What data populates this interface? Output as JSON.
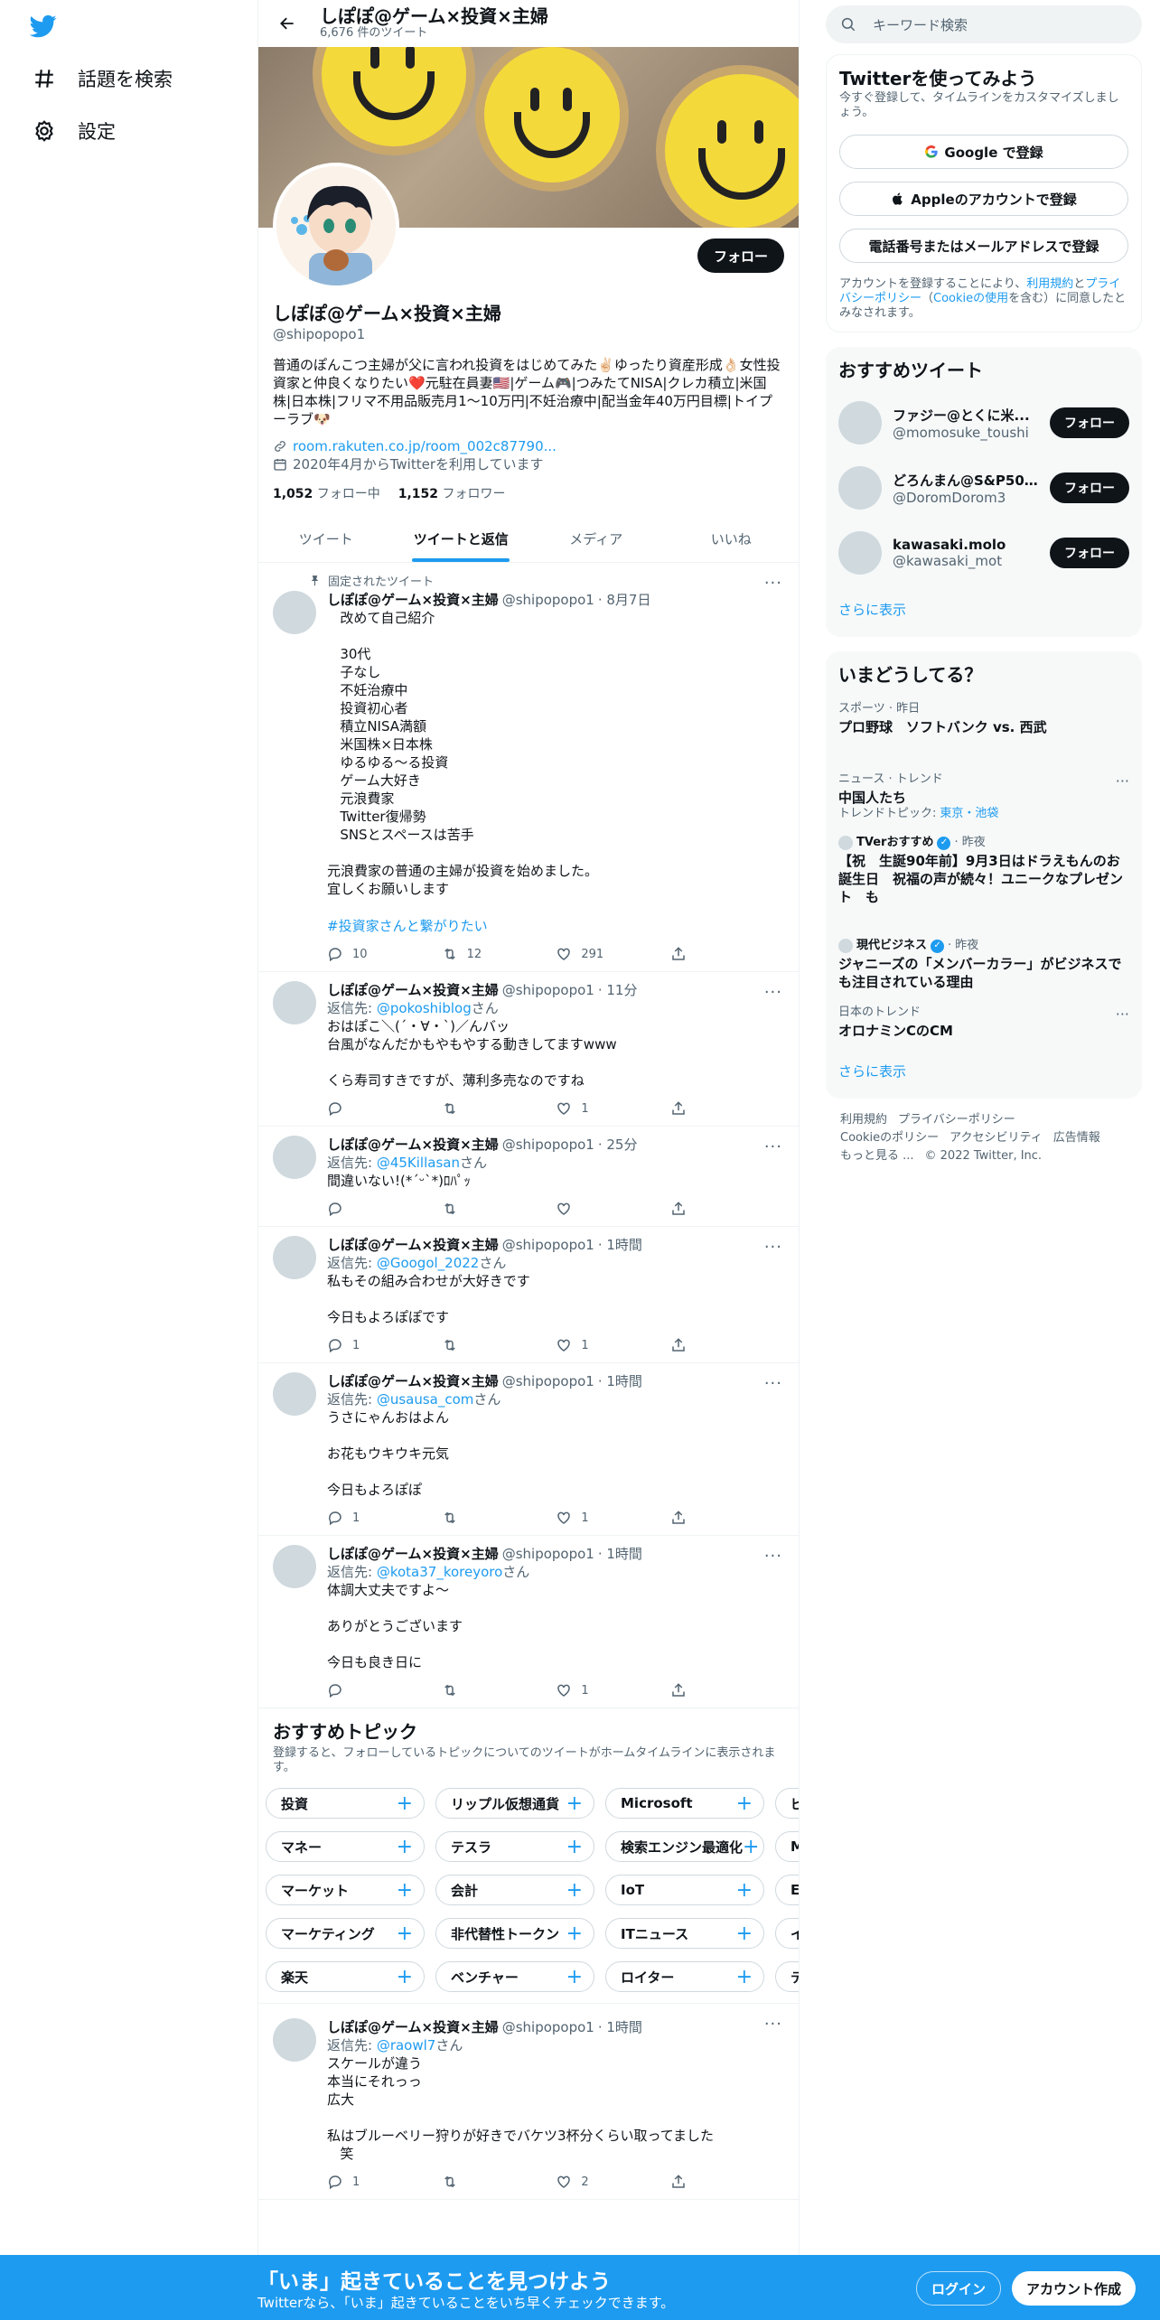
{
  "nav": {
    "explore_label": "話題を検索",
    "settings_label": "設定"
  },
  "header": {
    "title": "しぽぽ@ゲーム×投資×主婦",
    "tweet_count": "6,676 件のツイート"
  },
  "profile": {
    "follow_label": "フォロー",
    "name": "しぽぽ@ゲーム×投資×主婦",
    "handle": "@shipopopo1",
    "bio": "普通のぽんこつ主婦が父に言われ投資をはじめてみた✌🏻ゆったり資産形成👌🏻女性投資家と仲良くなりたい❤️元駐在員妻🇺🇸|ゲーム🎮|つみたてNISA|クレカ積立|米国株|日本株|フリマ不用品販売月1～10万円|不妊治療中|配当金年40万円目標|トイプーラブ🐶",
    "link": "room.rakuten.co.jp/room_002c87790...",
    "joined": "2020年4月からTwitterを利用しています",
    "following_count": "1,052",
    "following_label": "フォロー中",
    "followers_count": "1,152",
    "followers_label": "フォロワー"
  },
  "tabs": [
    {
      "label": "ツイート",
      "active": false
    },
    {
      "label": "ツイートと返信",
      "active": true
    },
    {
      "label": "メディア",
      "active": false
    },
    {
      "label": "いいね",
      "active": false
    }
  ],
  "pinned_label": "固定されたツイート",
  "tweets": [
    {
      "name": "しぽぽ@ゲーム×投資×主婦",
      "handle": "@shipopopo1",
      "time": "· 8月7日",
      "text": "   改めて自己紹介\n\n   30代\n   子なし\n   不妊治療中\n   投資初心者\n   積立NISA満額\n   米国株×日本株\n   ゆるゆる〜る投資\n   ゲーム大好き\n   元浪費家\n   Twitter復帰勢\n   SNSとスペースは苦手\n\n元浪費家の普通の主婦が投資を始めました。\n宜しくお願いします",
      "hashtag": "#投資家さんと繋がりたい",
      "replies": "10",
      "retweets": "12",
      "likes": "291"
    },
    {
      "name": "しぽぽ@ゲーム×投資×主婦",
      "handle": "@shipopopo1",
      "time": "· 11分",
      "reply_prefix": "返信先: ",
      "reply_to": "@pokoshiblog",
      "reply_suffix": "さん",
      "text": "おはぽこ＼(ˊ・∀・ˋ)／んバッ\n台風がなんだかもやもやする動きしてますwww\n\nくら寿司すきですが、薄利多売なのですね",
      "replies": "",
      "retweets": "",
      "likes": "1"
    },
    {
      "name": "しぽぽ@ゲーム×投資×主婦",
      "handle": "@shipopopo1",
      "time": "· 25分",
      "reply_prefix": "返信先: ",
      "reply_to": "@45Killasan",
      "reply_suffix": "さん",
      "text": "間違いない!(*ˊᵕˋ*)ﾛﾊﾟｯ",
      "replies": "",
      "retweets": "",
      "likes": ""
    },
    {
      "name": "しぽぽ@ゲーム×投資×主婦",
      "handle": "@shipopopo1",
      "time": "· 1時間",
      "reply_prefix": "返信先: ",
      "reply_to": "@Googol_2022",
      "reply_suffix": "さん",
      "text": "私もその組み合わせが大好きです\n\n今日もよろぽぽです",
      "replies": "1",
      "retweets": "",
      "likes": "1"
    },
    {
      "name": "しぽぽ@ゲーム×投資×主婦",
      "handle": "@shipopopo1",
      "time": "· 1時間",
      "reply_prefix": "返信先: ",
      "reply_to": "@usausa_com",
      "reply_suffix": "さん",
      "text": "うさにゃんおはよん\n\nお花もウキウキ元気\n\n今日もよろぽぽ",
      "replies": "1",
      "retweets": "",
      "likes": "1"
    },
    {
      "name": "しぽぽ@ゲーム×投資×主婦",
      "handle": "@shipopopo1",
      "time": "· 1時間",
      "reply_prefix": "返信先: ",
      "reply_to": "@kota37_koreyoro",
      "reply_suffix": "さん",
      "text": "体調大丈夫ですよ〜\n\nありがとうございます\n\n今日も良き日に",
      "replies": "",
      "retweets": "",
      "likes": "1"
    }
  ],
  "topics": {
    "title": "おすすめトピック",
    "desc": "登録すると、フォローしているトピックについてのツイートがホームタイムラインに表示されます。",
    "rows": [
      [
        "投資",
        "リップル仮想通貨",
        "Microsoft",
        "ビ"
      ],
      [
        "マネー",
        "テスラ",
        "検索エンジン最適化",
        "M"
      ],
      [
        "マーケット",
        "会計",
        "IoT",
        "E"
      ],
      [
        "マーケティング",
        "非代替性トークン",
        "ITニュース",
        "イ"
      ],
      [
        "楽天",
        "ベンチャー",
        "ロイター",
        "テ"
      ]
    ]
  },
  "last_tweet": {
    "name": "しぽぽ@ゲーム×投資×主婦",
    "handle": "@shipopopo1",
    "time": "· 1時間",
    "reply_prefix": "返信先: ",
    "reply_to": "@raowl7",
    "reply_suffix": "さん",
    "text": "スケールが違う\n本当にそれっっ\n広大\n\n私はブルーベリー狩りが好きでバケツ3杯分くらい取ってました\n   笑",
    "replies": "1",
    "retweets": "",
    "likes": "2"
  },
  "right": {
    "search_placeholder": "キーワード検索",
    "signup_title": "Twitterを使ってみよう",
    "signup_sub": "今すぐ登録して、タイムラインをカスタマイズしましょう。",
    "google_btn": "Google で登録",
    "apple_btn": "Appleのアカウントで登録",
    "phone_btn": "電話番号またはメールアドレスで登録",
    "terms_pre": "アカウントを登録することにより、",
    "terms_link1": "利用規約",
    "terms_mid1": "と",
    "terms_link2": "プライバシーポリシー",
    "terms_mid2": "（",
    "terms_link3": "Cookieの使用",
    "terms_post": "を含む）に同意したとみなされます。",
    "wtf_title": "おすすめツイート",
    "wtf": [
      {
        "name": "ファジー@とくに米...",
        "handle": "@momosuke_toushi",
        "btn": "フォロー"
      },
      {
        "name": "どろんまん@S&P50...",
        "handle": "@DoromDorom3",
        "btn": "フォロー"
      },
      {
        "name": "kawasaki.molo",
        "handle": "@kawasaki_mot",
        "btn": "フォロー"
      }
    ],
    "show_more": "さらに表示",
    "trends_title": "いまどうしてる？",
    "trends": [
      {
        "cat": "スポーツ · 昨日",
        "title": "プロ野球　ソフトバンク vs. 西武",
        "sub": ""
      },
      {
        "cat": "ニュース · トレンド",
        "title": "中国人たち",
        "sub_pre": "トレンドトピック: ",
        "sub_links": "東京・池袋"
      },
      {
        "cat": "TVerおすすめ",
        "cat_time": "· 昨夜",
        "title": "【祝　生誕90年前】9月3日はドラえもんのお誕生日　祝福の声が続々！ユニークなプレゼント　も"
      },
      {
        "cat": "現代ビジネス",
        "cat_time": "· 昨夜",
        "title": "ジャニーズの「メンバーカラー」がビジネスでも注目されている理由"
      },
      {
        "cat": "日本のトレンド",
        "title": "オロナミンCのCM"
      }
    ],
    "trends_more": "さらに表示",
    "footer": [
      "利用規約",
      "プライバシーポリシー",
      "Cookieのポリシー",
      "アクセシビリティ",
      "広告情報",
      "もっと見る ...",
      "© 2022 Twitter, Inc."
    ]
  },
  "bottom": {
    "headline": "「いま」起きていることを見つけよう",
    "sub": "Twitterなら、「いま」起きていることをいち早くチェックできます。",
    "login": "ログイン",
    "signup": "アカウント作成"
  },
  "colors": {
    "accent": "#1d9bf0",
    "text": "#0f1419",
    "muted": "#536471"
  }
}
